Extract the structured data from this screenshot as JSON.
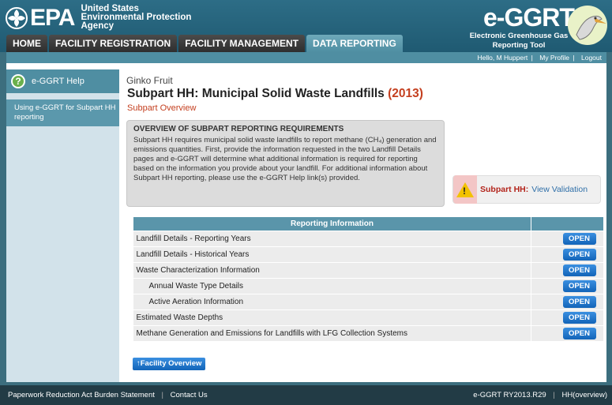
{
  "header": {
    "epa_label": "EPA",
    "agency_lines": [
      "United States",
      "Environmental Protection",
      "Agency"
    ],
    "app_title": "e-GGRT",
    "app_subtitle": "Electronic Greenhouse Gas Reporting Tool"
  },
  "tabs": [
    {
      "label": "HOME",
      "active": false
    },
    {
      "label": "FACILITY REGISTRATION",
      "active": false
    },
    {
      "label": "FACILITY MANAGEMENT",
      "active": false
    },
    {
      "label": "DATA REPORTING",
      "active": true
    }
  ],
  "userbar": {
    "greeting": "Hello, M Huppert",
    "my_profile": "My Profile",
    "logout": "Logout"
  },
  "sidebar": {
    "help_title": "e-GGRT Help",
    "help_link": "Using e-GGRT for Subpart HH reporting"
  },
  "main": {
    "facility_name": "Ginko Fruit",
    "title": "Subpart HH: Municipal Solid Waste Landfills",
    "year": "(2013)",
    "subtitle": "Subpart Overview",
    "overview_heading": "OVERVIEW OF SUBPART REPORTING REQUIREMENTS",
    "overview_text": "Subpart HH requires municipal solid waste landfills to report methane (CH₄) generation and emissions quantities. First, provide the information requested in the two Landfill Details pages and e-GGRT will determine what additional information is required for reporting based on the information you provide about your landfill. For additional information about Subpart HH reporting, please use the e-GGRT Help link(s) provided.",
    "validation_label": "Subpart HH:",
    "validation_link": "View Validation",
    "table_header": "Reporting Information",
    "rows": [
      {
        "label": "Landfill Details - Reporting Years",
        "indent": false,
        "button": "OPEN"
      },
      {
        "label": "Landfill Details - Historical Years",
        "indent": false,
        "button": "OPEN"
      },
      {
        "label": "Waste Characterization Information",
        "indent": false,
        "button": "OPEN"
      },
      {
        "label": "Annual Waste Type Details",
        "indent": true,
        "button": "OPEN"
      },
      {
        "label": "Active Aeration Information",
        "indent": true,
        "button": "OPEN"
      },
      {
        "label": "Estimated Waste Depths",
        "indent": false,
        "button": "OPEN"
      },
      {
        "label": "Methane Generation and Emissions for Landfills with LFG Collection Systems",
        "indent": false,
        "button": "OPEN"
      }
    ],
    "facility_overview_button": "Facility Overview"
  },
  "footer": {
    "paperwork": "Paperwork Reduction Act Burden Statement",
    "contact": "Contact Us",
    "version": "e-GGRT RY2013.R29",
    "page_id": "HH(overview)"
  },
  "colors": {
    "header_bg": "#2d6d86",
    "active_tab": "#5f9fb2",
    "accent_red": "#c43f1f",
    "button_blue": "#1a72c8"
  }
}
